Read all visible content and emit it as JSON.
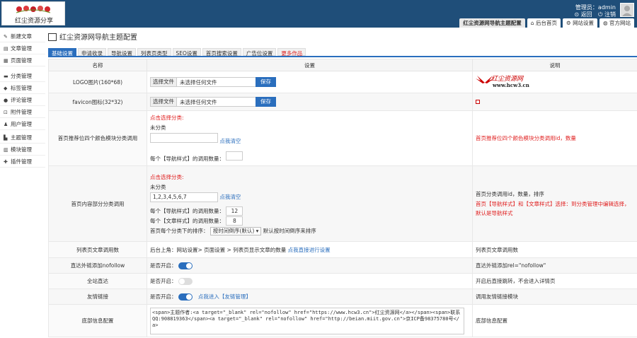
{
  "header": {
    "logo_text": "红尘资源分享",
    "user_label": "管理员：admin",
    "back": "返回",
    "logout": "注销",
    "tabs": [
      {
        "label": "红尘资源网导航主题配置"
      },
      {
        "label": "后台首页"
      },
      {
        "label": "网站设置"
      },
      {
        "label": "官方网站"
      }
    ]
  },
  "sidebar": {
    "items": [
      {
        "label": "新建文章",
        "icon": "edit-icon"
      },
      {
        "label": "文章管理",
        "icon": "article-icon"
      },
      {
        "label": "页面管理",
        "icon": "page-icon"
      },
      {
        "label": "分类管理",
        "icon": "folder-icon"
      },
      {
        "label": "标签管理",
        "icon": "tag-icon"
      },
      {
        "label": "评论管理",
        "icon": "comment-icon"
      },
      {
        "label": "附件管理",
        "icon": "attachment-icon"
      },
      {
        "label": "用户管理",
        "icon": "user-icon"
      },
      {
        "label": "主题管理",
        "icon": "theme-icon"
      },
      {
        "label": "模块管理",
        "icon": "module-icon"
      },
      {
        "label": "插件管理",
        "icon": "plugin-icon"
      }
    ]
  },
  "page": {
    "title": "红尘资源网导航主题配置",
    "tabs": [
      {
        "label": "基础设置"
      },
      {
        "label": "申请收录"
      },
      {
        "label": "导航设置"
      },
      {
        "label": "列表页类型"
      },
      {
        "label": "SEO设置"
      },
      {
        "label": "首页搜索设置"
      },
      {
        "label": "广告位设置"
      },
      {
        "label": "更多作品"
      }
    ]
  },
  "table": {
    "headers": [
      "名称",
      "设置",
      "说明"
    ],
    "logo": {
      "name": "LOGO图片(160*68)",
      "file_btn": "选择文件",
      "file_none": "未选择任何文件",
      "save": "保存",
      "preview_title": "红尘资源网",
      "preview_url": "www.hcw3.cn"
    },
    "favicon": {
      "name": "favicon图标(32*32)",
      "file_btn": "选择文件",
      "file_none": "未选择任何文件",
      "save": "保存"
    },
    "four": {
      "name": "首页推荐位四个颜色模块分类调用",
      "pick": "点击选择分类:",
      "uncat": "未分类",
      "value": "",
      "clear": "点我清空",
      "count_label": "每个【导航样式】的调用数量：",
      "count": "",
      "desc": "首页推荐位四个颜色模块分类调用id，数量"
    },
    "inner": {
      "name": "首页内容部分分类调用",
      "pick": "点击选择分类:",
      "uncat": "未分类",
      "value": "1,2,3,4,5,6,7",
      "clear": "点我清空",
      "nav_label": "每个【导航样式】的调用数量：",
      "nav_count": "12",
      "art_label": "每个【文章样式】的调用数量：",
      "art_count": "8",
      "order_label": "首页每个分类下的排序：",
      "order_value": "按时间倒序(默认)",
      "order_hint": "默认按时间倒序来排序",
      "desc1": "首页分类调用id，数量，排序",
      "desc2": "首页【导航样式】和【文章样式】选择：到分类管理中编辑选择，默认是导航样式"
    },
    "list": {
      "name": "列表页文章调用数",
      "text": "后台上角：网站设置> 页面设置 > 列表页显示文章的数量",
      "link": "点我直接进行设置",
      "desc": "列表页文章调用数"
    },
    "nofollow": {
      "name": "直达外链添加nofollow",
      "label": "是否开启：",
      "desc": "直达外链添加rel=\"nofollow\""
    },
    "direct": {
      "name": "全站直达",
      "label": "是否开启：",
      "desc": "开启后直接跳转，不会进入详情页"
    },
    "friend": {
      "name": "友情链接",
      "label": "是否开启：",
      "link": "点我进入【友链管理】",
      "desc": "调用友情链接模块"
    },
    "footer": {
      "name": "底部信息配置",
      "code": "<span>主题作者:<a target=\"_blank\" rel=\"nofollow\" href=\"https://www.hcw3.cn\">红尘资源网</a></span><span>联系QQ:908819363</span><a target=\"_blank\" rel=\"nofollow\" href=\"http://beian.miit.gov.cn\">京ICP备98375780号</a>",
      "desc": "底部信息配置"
    }
  }
}
